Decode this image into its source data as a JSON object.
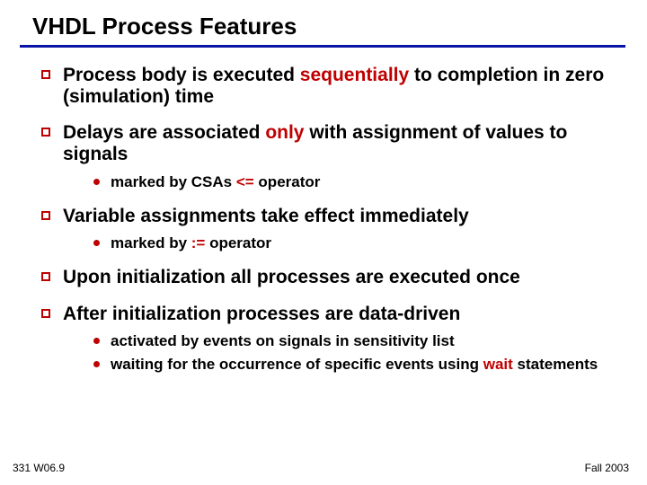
{
  "title": "VHDL Process Features",
  "bullets": {
    "b1": {
      "pre": "Process body is executed ",
      "em": "sequentially",
      "post": " to completion in zero (simulation) time"
    },
    "b2": {
      "pre": "Delays are associated ",
      "em": "only",
      "post": " with assignment of values to signals"
    },
    "b2s1": {
      "pre": "marked by CSAs  ",
      "em": "<=",
      "post": " operator"
    },
    "b3": {
      "text": "Variable assignments take effect immediately"
    },
    "b3s1": {
      "pre": "marked by ",
      "em": ":=",
      "post": " operator"
    },
    "b4": {
      "text": "Upon initialization all processes are executed once"
    },
    "b5": {
      "text": "After initialization processes are data-driven"
    },
    "b5s1": {
      "text": "activated by events on signals in sensitivity list"
    },
    "b5s2": {
      "pre": "waiting for the occurrence of specific events using ",
      "em": "wait",
      "post": " statements"
    }
  },
  "footer": {
    "left": "331 W06.9",
    "right": "Fall 2003"
  }
}
